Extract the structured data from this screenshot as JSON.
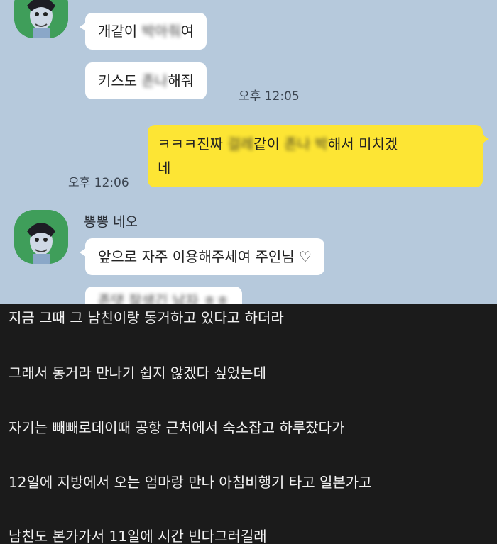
{
  "chat": {
    "top_sender": "",
    "messages_top": [
      {
        "pre": "개같이 ",
        "blurred": "박아줘",
        "post": "여"
      },
      {
        "pre": "키스도 ",
        "blurred": "존나",
        "post": "해줘"
      }
    ],
    "time_1": "오후 12:05",
    "my_message": {
      "pre": "ㅋㅋㅋ진짜 ",
      "blurred1": "걸레",
      "mid": "같이 ",
      "blurred2": "존나 박",
      "post": "해서 미치겠",
      "line2": "네"
    },
    "time_2": "오후 12:06",
    "sender_name": "뽕뽕 네오",
    "messages_bottom": [
      {
        "text": "앞으로 자주 이용해주세여 주인님 ",
        "heart": "♡"
      },
      {
        "blurred": "존댓 잘생긴 남자 ㅎㅎ"
      }
    ]
  },
  "post": {
    "lines": [
      "지금 그때 그 남친이랑 동거하고 있다고 하더라",
      "그래서 동거라 만나기 쉽지 않겠다 싶었는데",
      "자기는 빼빼로데이때 공항 근처에서 숙소잡고 하루잤다가",
      "12일에 지방에서 오는 엄마랑 만나 아침비행기 타고 일본가고",
      "남친도 본가가서 11일에 시간 빈다그러길래"
    ]
  },
  "colors": {
    "chat_bg": "#b6c9dc",
    "incoming_bubble": "#ffffff",
    "outgoing_bubble": "#fde534",
    "post_bg": "#1b1b1b",
    "post_text": "#f1f1f1",
    "avatar_bg": "#3f9e5a"
  },
  "icons": {
    "avatar": "neo-character-avatar-icon"
  }
}
